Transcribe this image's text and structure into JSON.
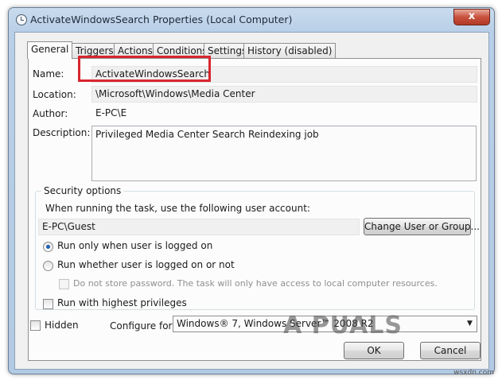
{
  "window": {
    "title": "ActivateWindowsSearch Properties (Local Computer)",
    "close_label": "x"
  },
  "tabs": [
    {
      "label": "General",
      "active": true
    },
    {
      "label": "Triggers"
    },
    {
      "label": "Actions"
    },
    {
      "label": "Conditions"
    },
    {
      "label": "Settings"
    },
    {
      "label": "History (disabled)"
    }
  ],
  "general": {
    "name_label": "Name:",
    "name_value": "ActivateWindowsSearch",
    "location_label": "Location:",
    "location_value": "\\Microsoft\\Windows\\Media Center",
    "author_label": "Author:",
    "author_value": "E-PC\\E",
    "description_label": "Description:",
    "description_value": "Privileged Media Center Search Reindexing job"
  },
  "security": {
    "title": "Security options",
    "account_prompt": "When running the task, use the following user account:",
    "account_value": "E-PC\\Guest",
    "change_user_button": "Change User or Group...",
    "radio_logged_on": "Run only when user is logged on",
    "radio_whether": "Run whether user is logged on or not",
    "no_store_password": "Do not store password.  The task will only have access to local computer resources.",
    "highest_privileges": "Run with highest privileges"
  },
  "bottom": {
    "hidden_label": "Hidden",
    "configure_label": "Configure for:",
    "configure_value": "Windows® 7, Windows Server™ 2008 R2",
    "ok_button": "OK",
    "cancel_button": "Cancel"
  },
  "watermark": "A PUALS",
  "footer_mark": "wsxdn.com",
  "colors": {
    "highlight_box": "#d8262f",
    "radio_selected": "#1f5fb0"
  }
}
